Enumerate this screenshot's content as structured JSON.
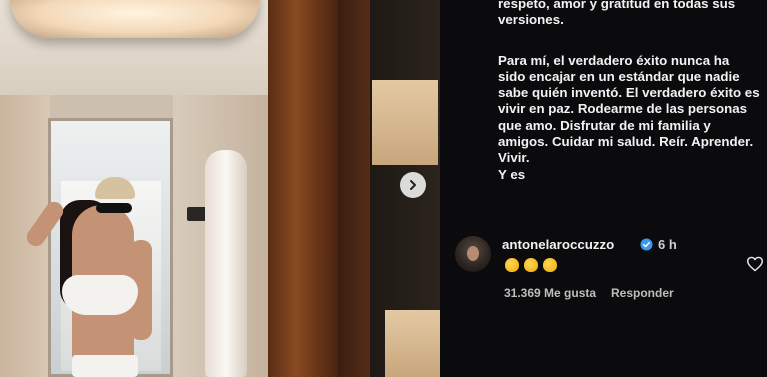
{
  "post": {
    "caption_line_top": "respeto, amor y gratitud en todas sus versiones.",
    "caption_paragraph": "Para mí, el verdadero éxito nunca ha sido encajar en un estándar que nadie sabe quién inventó. El verdadero éxito es vivir en paz. Rodearme de las personas que amo. Disfrutar de mi familia y amigos. Cuidar mi salud. Reír. Aprender. Vivir.",
    "caption_tail": "Y es"
  },
  "comment": {
    "username": "antonelaroccuzzo",
    "time": "6 h",
    "emoji_count": 3,
    "emoji_icon": "clapping-hands-icon",
    "likes_text": "31.369 Me gusta",
    "reply_label": "Responder"
  },
  "icons": {
    "next": "chevron-right-icon",
    "verified": "verified-badge-icon",
    "like": "heart-outline-icon"
  },
  "colors": {
    "background": "#0b0b0d",
    "verified": "#3897f0",
    "text": "#f2f2f2",
    "muted": "#bdbdbd"
  }
}
